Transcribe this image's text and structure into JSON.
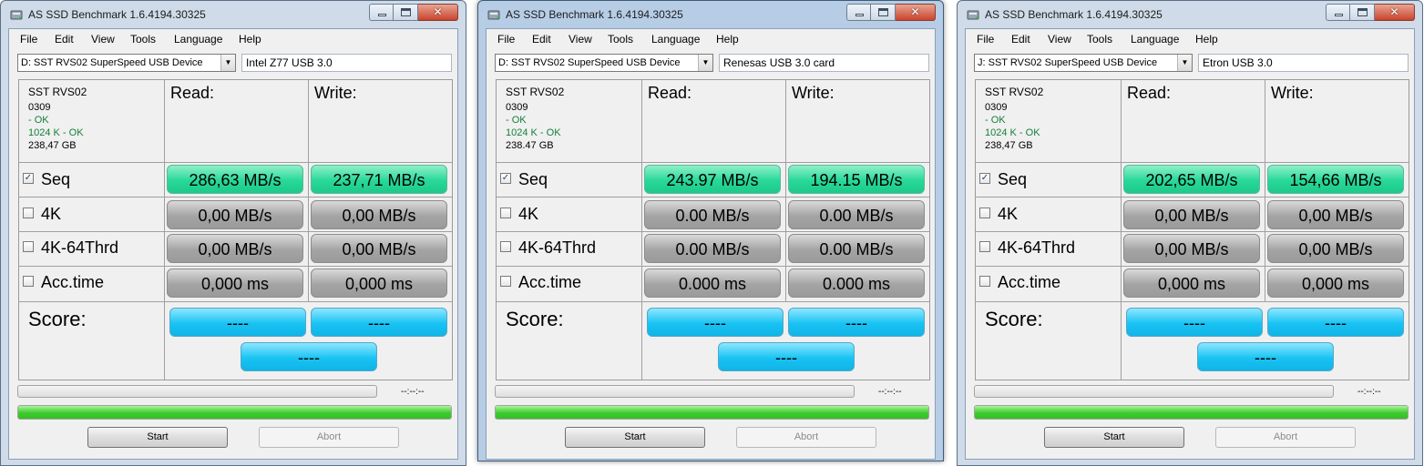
{
  "windows": [
    {
      "title": "AS SSD Benchmark 1.6.4194.30325",
      "menu": [
        "File",
        "Edit",
        "View",
        "Tools",
        "Language",
        "Help"
      ],
      "drive": "D: SST RVS02 SuperSpeed USB Device",
      "note": "Intel Z77 USB 3.0",
      "info": {
        "model": "SST RVS02",
        "firmware": "0309",
        "driver_status": " - OK",
        "alignment": "1024 K - OK",
        "size": "238,47 GB"
      },
      "headers": {
        "read": "Read:",
        "write": "Write:"
      },
      "rows": [
        {
          "label": "Seq",
          "checked": true,
          "read": "286,63 MB/s",
          "write": "237,71 MB/s"
        },
        {
          "label": "4K",
          "checked": false,
          "read": "0,00 MB/s",
          "write": "0,00 MB/s"
        },
        {
          "label": "4K-64Thrd",
          "checked": false,
          "read": "0,00 MB/s",
          "write": "0,00 MB/s"
        },
        {
          "label": "Acc.time",
          "checked": false,
          "read": "0,000 ms",
          "write": "0,000 ms"
        }
      ],
      "score": {
        "label": "Score:",
        "read": "----",
        "write": "----",
        "total": "----"
      },
      "time": "--:--:--",
      "progress_top": 0,
      "progress_bottom": 1,
      "buttons": {
        "start": "Start",
        "abort": "Abort"
      }
    },
    {
      "title": "AS SSD Benchmark 1.6.4194.30325",
      "menu": [
        "File",
        "Edit",
        "View",
        "Tools",
        "Language",
        "Help"
      ],
      "drive": "D: SST RVS02 SuperSpeed USB Device",
      "note": "Renesas USB 3.0 card",
      "info": {
        "model": "SST RVS02",
        "firmware": "0309",
        "driver_status": " - OK",
        "alignment": "1024 K - OK",
        "size": "238.47 GB"
      },
      "headers": {
        "read": "Read:",
        "write": "Write:"
      },
      "rows": [
        {
          "label": "Seq",
          "checked": true,
          "read": "243.97 MB/s",
          "write": "194.15 MB/s"
        },
        {
          "label": "4K",
          "checked": false,
          "read": "0.00 MB/s",
          "write": "0.00 MB/s"
        },
        {
          "label": "4K-64Thrd",
          "checked": false,
          "read": "0.00 MB/s",
          "write": "0.00 MB/s"
        },
        {
          "label": "Acc.time",
          "checked": false,
          "read": "0.000 ms",
          "write": "0.000 ms"
        }
      ],
      "score": {
        "label": "Score:",
        "read": "----",
        "write": "----",
        "total": "----"
      },
      "time": "--:--:--",
      "progress_top": 0,
      "progress_bottom": 1,
      "buttons": {
        "start": "Start",
        "abort": "Abort"
      }
    },
    {
      "title": "AS SSD Benchmark 1.6.4194.30325",
      "menu": [
        "File",
        "Edit",
        "View",
        "Tools",
        "Language",
        "Help"
      ],
      "drive": "J: SST RVS02 SuperSpeed USB Device",
      "note": "Etron USB 3.0",
      "info": {
        "model": "SST RVS02",
        "firmware": "0309",
        "driver_status": " - OK",
        "alignment": "1024 K - OK",
        "size": "238,47 GB"
      },
      "headers": {
        "read": "Read:",
        "write": "Write:"
      },
      "rows": [
        {
          "label": "Seq",
          "checked": true,
          "read": "202,65 MB/s",
          "write": "154,66 MB/s"
        },
        {
          "label": "4K",
          "checked": false,
          "read": "0,00 MB/s",
          "write": "0,00 MB/s"
        },
        {
          "label": "4K-64Thrd",
          "checked": false,
          "read": "0,00 MB/s",
          "write": "0,00 MB/s"
        },
        {
          "label": "Acc.time",
          "checked": false,
          "read": "0,000 ms",
          "write": "0,000 ms"
        }
      ],
      "score": {
        "label": "Score:",
        "read": "----",
        "write": "----",
        "total": "----"
      },
      "time": "--:--:--",
      "progress_top": 0,
      "progress_bottom": 1,
      "buttons": {
        "start": "Start",
        "abort": "Abort"
      }
    }
  ],
  "icons": {
    "app": "hard-drive-icon",
    "dropdown": "chevron-down-icon",
    "checkbox": "checkmark-icon"
  },
  "colors": {
    "result_green": "#27d89a",
    "result_gray": "#a4a4a4",
    "score_blue": "#18c3f3",
    "progress_green": "#3ecb2e",
    "ok_text": "#16803a"
  }
}
